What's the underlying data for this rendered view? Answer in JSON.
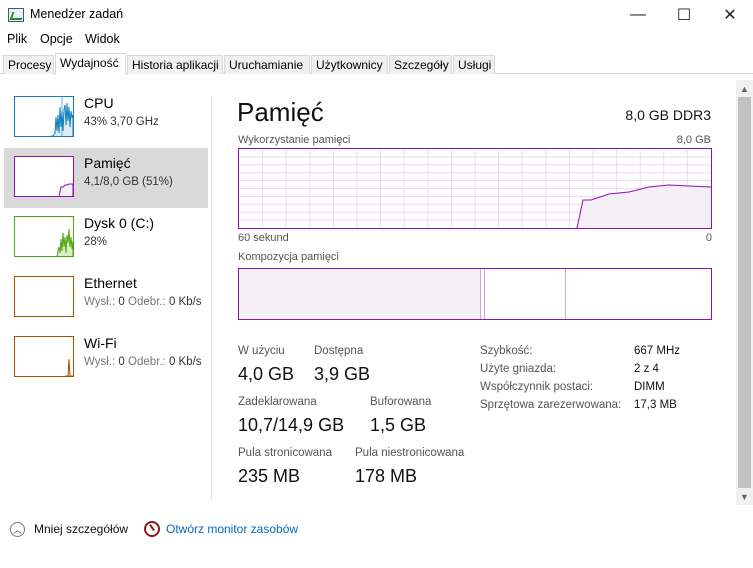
{
  "window": {
    "title": "Menedżer zadań",
    "controls": {
      "minimize": "—",
      "maximize": "☐",
      "close": "✕"
    }
  },
  "menu": [
    "Plik",
    "Opcje",
    "Widok"
  ],
  "tabs": [
    {
      "label": "Procesy",
      "active": false
    },
    {
      "label": "Wydajność",
      "active": true
    },
    {
      "label": "Historia aplikacji",
      "active": false
    },
    {
      "label": "Uruchamianie",
      "active": false
    },
    {
      "label": "Użytkownicy",
      "active": false
    },
    {
      "label": "Szczegóły",
      "active": false
    },
    {
      "label": "Usługi",
      "active": false
    }
  ],
  "sidebar": {
    "items": [
      {
        "name": "CPU",
        "sub": "43% 3,70 GHz",
        "color": "#117dbb",
        "selected": false
      },
      {
        "name": "Pamięć",
        "sub": "4,1/8,0 GB (51%)",
        "color": "#8b12ae",
        "selected": true
      },
      {
        "name": "Dysk 0 (C:)",
        "sub": "28%",
        "color": "#4da60c",
        "selected": false
      },
      {
        "name": "Ethernet",
        "sub_label1": "Wysł.:",
        "sub_value1": "0",
        "sub_label2": "Odebr.:",
        "sub_value2": "0 Kb/s",
        "color": "#a74f01",
        "selected": false
      },
      {
        "name": "Wi-Fi",
        "sub_label1": "Wysł.:",
        "sub_value1": "0",
        "sub_label2": "Odebr.:",
        "sub_value2": "0 Kb/s",
        "color": "#a74f01",
        "selected": false
      }
    ]
  },
  "main": {
    "title": "Pamięć",
    "memory_type": "8,0 GB DDR3",
    "usage_graph": {
      "label": "Wykorzystanie pamięci",
      "max_label": "8,0 GB",
      "time_label": "60 sekund",
      "min_label": "0",
      "color": "#8b12ae"
    },
    "composition": {
      "label": "Kompozycja pamięci",
      "in_use_fraction": 0.51,
      "standby_fraction": 0.69
    },
    "stats": {
      "in_use": {
        "label": "W użyciu",
        "value": "4,0 GB"
      },
      "available": {
        "label": "Dostępna",
        "value": "3,9 GB"
      },
      "committed": {
        "label": "Zadeklarowana",
        "value": "10,7/14,9 GB"
      },
      "cached": {
        "label": "Buforowana",
        "value": "1,5 GB"
      },
      "paged_pool": {
        "label": "Pula stronicowana",
        "value": "235 MB"
      },
      "nonpaged_pool": {
        "label": "Pula niestronicowana",
        "value": "178 MB"
      }
    },
    "properties": [
      {
        "key": "Szybkość:",
        "value": "667 MHz"
      },
      {
        "key": "Użyte gniazda:",
        "value": "2 z 4"
      },
      {
        "key": "Współczynnik postaci:",
        "value": "DIMM"
      },
      {
        "key": "Sprzętowa zarezerwowana:",
        "value": "17,3 MB"
      }
    ]
  },
  "footer": {
    "less_details": "Mniej szczegółów",
    "resource_monitor": "Otwórz monitor zasobów"
  }
}
